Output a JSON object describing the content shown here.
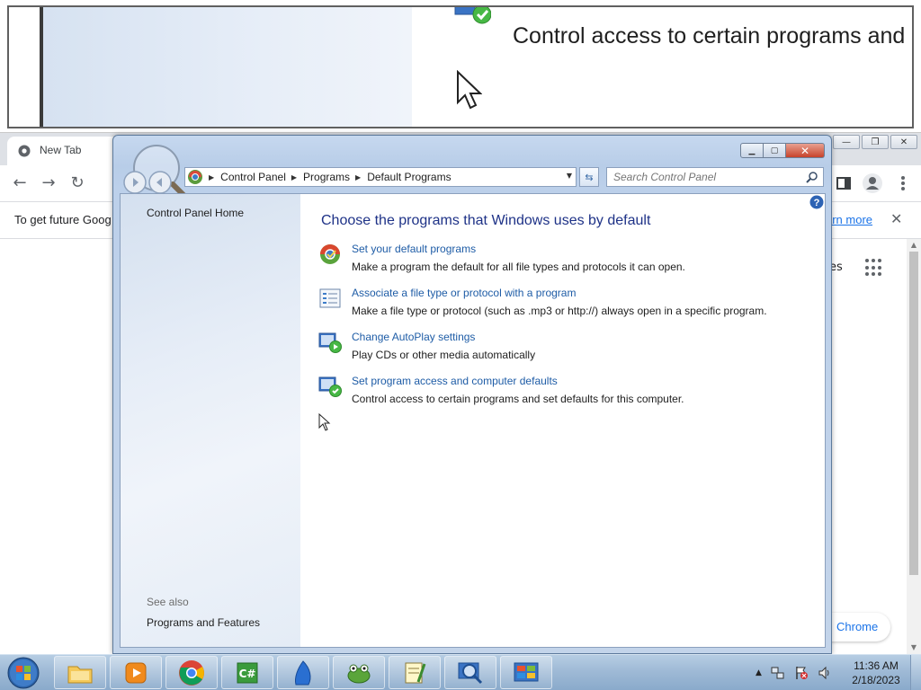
{
  "zoom": {
    "text": "Control access to certain programs and set"
  },
  "chrome": {
    "tab_label": "New Tab",
    "caption": {
      "minimize": "—",
      "restore": "❐",
      "close": "✕"
    },
    "infobar_text": "To get future Goog",
    "infobar_link": "arn more",
    "infobar_close": "✕",
    "apps_label": "es",
    "customize_label": "Chrome"
  },
  "cp": {
    "caption": {
      "minimize": "▁",
      "maximize": "▢",
      "close": "✕"
    },
    "breadcrumbs": [
      "Control Panel",
      "Programs",
      "Default Programs"
    ],
    "search_placeholder": "Search Control Panel",
    "left": {
      "home": "Control Panel Home",
      "see_also": "See also",
      "programs_features": "Programs and Features"
    },
    "title": "Choose the programs that Windows uses by default",
    "tasks": [
      {
        "link": "Set your default programs",
        "desc": "Make a program the default for all file types and protocols it can open."
      },
      {
        "link": "Associate a file type or protocol with a program",
        "desc": "Make a file type or protocol (such as .mp3 or http://) always open in a specific program."
      },
      {
        "link": "Change AutoPlay settings",
        "desc": "Play CDs or other media automatically"
      },
      {
        "link": "Set program access and computer defaults",
        "desc": "Control access to certain programs and set defaults for this computer."
      }
    ]
  },
  "taskbar": {
    "time": "11:36 AM",
    "date": "2/18/2023"
  },
  "colors": {
    "link": "#1e5ca6",
    "title": "#1e3287",
    "chrome_accent": "#1a73e8"
  }
}
